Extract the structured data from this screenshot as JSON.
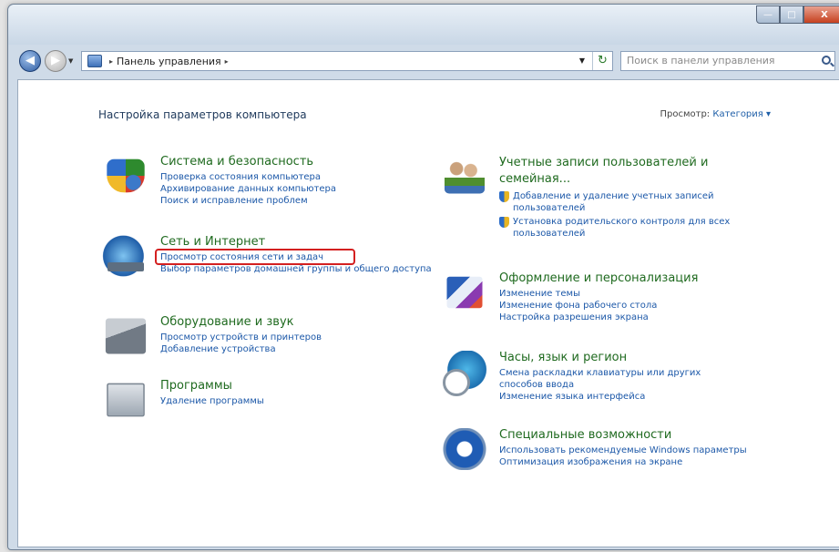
{
  "window": {
    "caption_buttons": {
      "min": "—",
      "max": "□",
      "close": "X"
    }
  },
  "address_bar": {
    "back_glyph": "◀",
    "forward_glyph": "▶",
    "history_glyph": "▼",
    "breadcrumb": "Панель управления",
    "separator": "▸",
    "dropdown_glyph": "▼",
    "refresh_glyph": "↻",
    "icon": "control-panel-icon"
  },
  "search": {
    "placeholder": "Поиск в панели управления"
  },
  "page": {
    "title": "Настройка параметров компьютера",
    "view_by_label": "Просмотр:",
    "view_by_value": "Категория ▾"
  },
  "left_categories": [
    {
      "title": "Система и безопасность",
      "icon": "security-shield-icon",
      "links": [
        "Проверка состояния компьютера",
        "Архивирование данных компьютера",
        "Поиск и исправление проблем"
      ]
    },
    {
      "title": "Сеть и Интернет",
      "icon": "network-globe-icon",
      "links": [
        "Просмотр состояния сети и задач",
        "Выбор параметров домашней группы и общего доступа"
      ]
    },
    {
      "title": "Оборудование и звук",
      "icon": "printer-hardware-icon",
      "links": [
        "Просмотр устройств и принтеров",
        "Добавление устройства"
      ]
    },
    {
      "title": "Программы",
      "icon": "programs-icon",
      "links": [
        "Удаление программы"
      ]
    }
  ],
  "right_categories": [
    {
      "title": "Учетные записи пользователей и семейная...",
      "icon": "users-icon",
      "links": [
        "Добавление и удаление учетных записей пользователей",
        "Установка родительского контроля для всех пользователей"
      ]
    },
    {
      "title": "Оформление и персонализация",
      "icon": "appearance-icon",
      "links": [
        "Изменение темы",
        "Изменение фона рабочего стола",
        "Настройка разрешения экрана"
      ]
    },
    {
      "title": "Часы, язык и регион",
      "icon": "clock-globe-icon",
      "links": [
        "Смена раскладки клавиатуры или других способов ввода",
        "Изменение языка интерфейса"
      ]
    },
    {
      "title": "Специальные возможности",
      "icon": "accessibility-icon",
      "links": [
        "Использовать рекомендуемые Windows параметры",
        "Оптимизация изображения на экране"
      ]
    }
  ],
  "colors": {
    "highlight": "#d42020",
    "link": "#1c58a8",
    "category_title": "#1f6a1f"
  }
}
